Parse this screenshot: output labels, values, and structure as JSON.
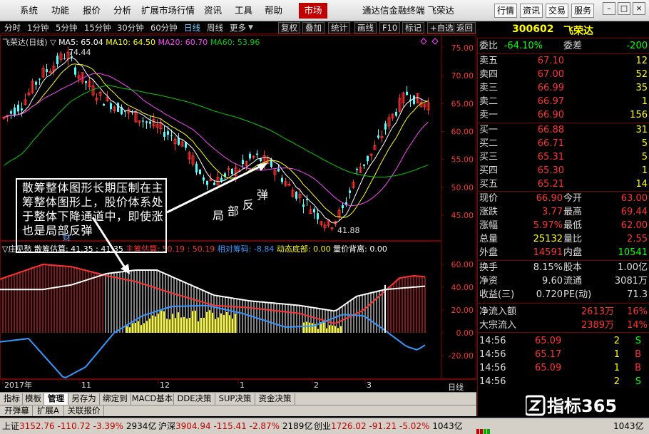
{
  "menu": {
    "items": [
      "系统",
      "功能",
      "报价",
      "分析",
      "扩展市场行情",
      "资讯",
      "工具",
      "帮助"
    ],
    "active": "市场",
    "title": "通达信金融终端  飞荣达",
    "right_buttons": [
      "行情",
      "资讯",
      "交易",
      "服务"
    ]
  },
  "toolbar": {
    "periods": [
      "分时",
      "1分钟",
      "5分钟",
      "15分钟",
      "30分钟",
      "60分钟",
      "日线",
      "周线",
      "更多"
    ],
    "selected_period": "日线",
    "tools": [
      "复权",
      "叠加",
      "统计",
      "画线",
      "F10",
      "标记",
      "+自选",
      "返回"
    ]
  },
  "stock": {
    "code": "300602",
    "name": "飞荣达"
  },
  "colors": {
    "up": "#ff3232",
    "down": "#54ffff",
    "ma5": "#ffffff",
    "ma10": "#ffff00",
    "ma20": "#ff44ff",
    "ma60": "#00cc00",
    "frame": "#7a0000"
  },
  "chart": {
    "title_label": "飞荣达(日线)",
    "ma_legend": [
      {
        "label": "MA5: 65.04",
        "color": "#ffffff"
      },
      {
        "label": "MA10: 64.50",
        "color": "#ffff00"
      },
      {
        "label": "MA20: 60.70",
        "color": "#ff44ff"
      },
      {
        "label": "MA60: 53.96",
        "color": "#00cc00"
      }
    ],
    "high_label": "74.44",
    "low_label": "41.88",
    "price_axis": [
      "75.00",
      "70.00",
      "65.00",
      "60.00",
      "55.00",
      "50.00",
      "45.00"
    ],
    "date_labels": [
      "2017年",
      "11",
      "12",
      "1",
      "2",
      "3"
    ],
    "period_tag": "日线",
    "cai_label": "财"
  },
  "indicator": {
    "legend": [
      {
        "label": "▽庄见愁",
        "color": "#ffffff"
      },
      {
        "label": "散筹估算: 41.35 : 41.35",
        "color": "#ffffff"
      },
      {
        "label": "主筹估算: 50.19 : 50.19",
        "color": "#ff3232"
      },
      {
        "label": "相对筹码: -8.84",
        "color": "#3399ff"
      },
      {
        "label": "动态底部: 0.00",
        "color": "#ffff00"
      },
      {
        "label": "量价背离: 0.00",
        "color": "#ffffff"
      }
    ],
    "axis": [
      "60.00",
      "40.00",
      "20.00",
      "0.00",
      "-20.00"
    ]
  },
  "annotation": {
    "text": "散筹整体图形长期压制在主筹整体图形上，股价体系处于整体下降通道中，即使涨也是局部反弹",
    "chars": [
      "局",
      "部",
      "反",
      "弹"
    ]
  },
  "side": {
    "weibi": {
      "label": "委比",
      "value": "-64.10%",
      "label2": "委差",
      "value2": "-200"
    },
    "sell": [
      {
        "label": "卖五",
        "price": "67.10",
        "vol": "12"
      },
      {
        "label": "卖四",
        "price": "67.00",
        "vol": "52"
      },
      {
        "label": "卖三",
        "price": "66.99",
        "vol": "35"
      },
      {
        "label": "卖二",
        "price": "66.97",
        "vol": "1"
      },
      {
        "label": "卖一",
        "price": "66.90",
        "vol": "156"
      }
    ],
    "buy": [
      {
        "label": "买一",
        "price": "66.88",
        "vol": "31"
      },
      {
        "label": "买二",
        "price": "66.71",
        "vol": "5"
      },
      {
        "label": "买三",
        "price": "65.31",
        "vol": "5"
      },
      {
        "label": "买四",
        "price": "65.30",
        "vol": "1"
      },
      {
        "label": "买五",
        "price": "65.21",
        "vol": "14"
      }
    ],
    "quote": [
      {
        "l1": "现价",
        "v1": "66.90",
        "c1": "#ff3232",
        "l2": "今开",
        "v2": "63.00",
        "c2": "#ff3232"
      },
      {
        "l1": "涨跌",
        "v1": "3.77",
        "c1": "#ff3232",
        "l2": "最高",
        "v2": "69.44",
        "c2": "#ff3232"
      },
      {
        "l1": "涨幅",
        "v1": "5.97%",
        "c1": "#ff3232",
        "l2": "最低",
        "v2": "62.00",
        "c2": "#ff3232"
      },
      {
        "l1": "总量",
        "v1": "25132",
        "c1": "#ffff00",
        "l2": "量比",
        "v2": "2.55",
        "c2": "#ff3232"
      },
      {
        "l1": "外盘",
        "v1": "14591",
        "c1": "#ff3232",
        "l2": "内盘",
        "v2": "10541",
        "c2": "#00ff00"
      }
    ],
    "fund": [
      {
        "l1": "换手",
        "v1": "8.15%",
        "l2": "股本",
        "v2": "1.00亿"
      },
      {
        "l1": "净资",
        "v1": "9.60",
        "l2": "流通",
        "v2": "3081万"
      },
      {
        "l1": "收益(三)",
        "v1": "0.720",
        "l2": "PE(动)",
        "v2": "71.3"
      }
    ],
    "flow": [
      {
        "label": "净流入额",
        "value": "2613万",
        "pct": "16%"
      },
      {
        "label": "大宗流入",
        "value": "2389万",
        "pct": "14%"
      }
    ],
    "ticks": [
      {
        "time": "14:56",
        "price": "65.09",
        "vol": "2",
        "dir": "S"
      },
      {
        "time": "14:56",
        "price": "65.17",
        "vol": "1",
        "dir": "B"
      },
      {
        "time": "14:56",
        "price": "65.09",
        "vol": "1",
        "dir": "B"
      },
      {
        "time": "14:56",
        "price": "",
        "vol": "2",
        "dir": "S"
      }
    ]
  },
  "tabs": [
    "指标",
    "模板",
    "管理",
    "另存为",
    "绑定到",
    "MACD基本",
    "DDE决策",
    "SUP决策",
    "资金决策"
  ],
  "tabs_active": "管理",
  "tabs2": [
    "开弹幕",
    "扩展A",
    "关联报价"
  ],
  "status": {
    "sh": {
      "label": "上证",
      "price": "3152.76",
      "chg": "-110.72",
      "pct": "-3.39%",
      "amt": "2934亿"
    },
    "sz": {
      "label": "沪深",
      "price": "3904.94",
      "chg": "-115.41",
      "pct": "-2.87%",
      "amt": "2189亿"
    },
    "cy": {
      "label": "创业",
      "price": "1726.02",
      "chg": "-91.21",
      "pct": "-5.02%",
      "amt": "1043亿"
    },
    "extra": "1043亿"
  },
  "watermark": "指标365"
}
